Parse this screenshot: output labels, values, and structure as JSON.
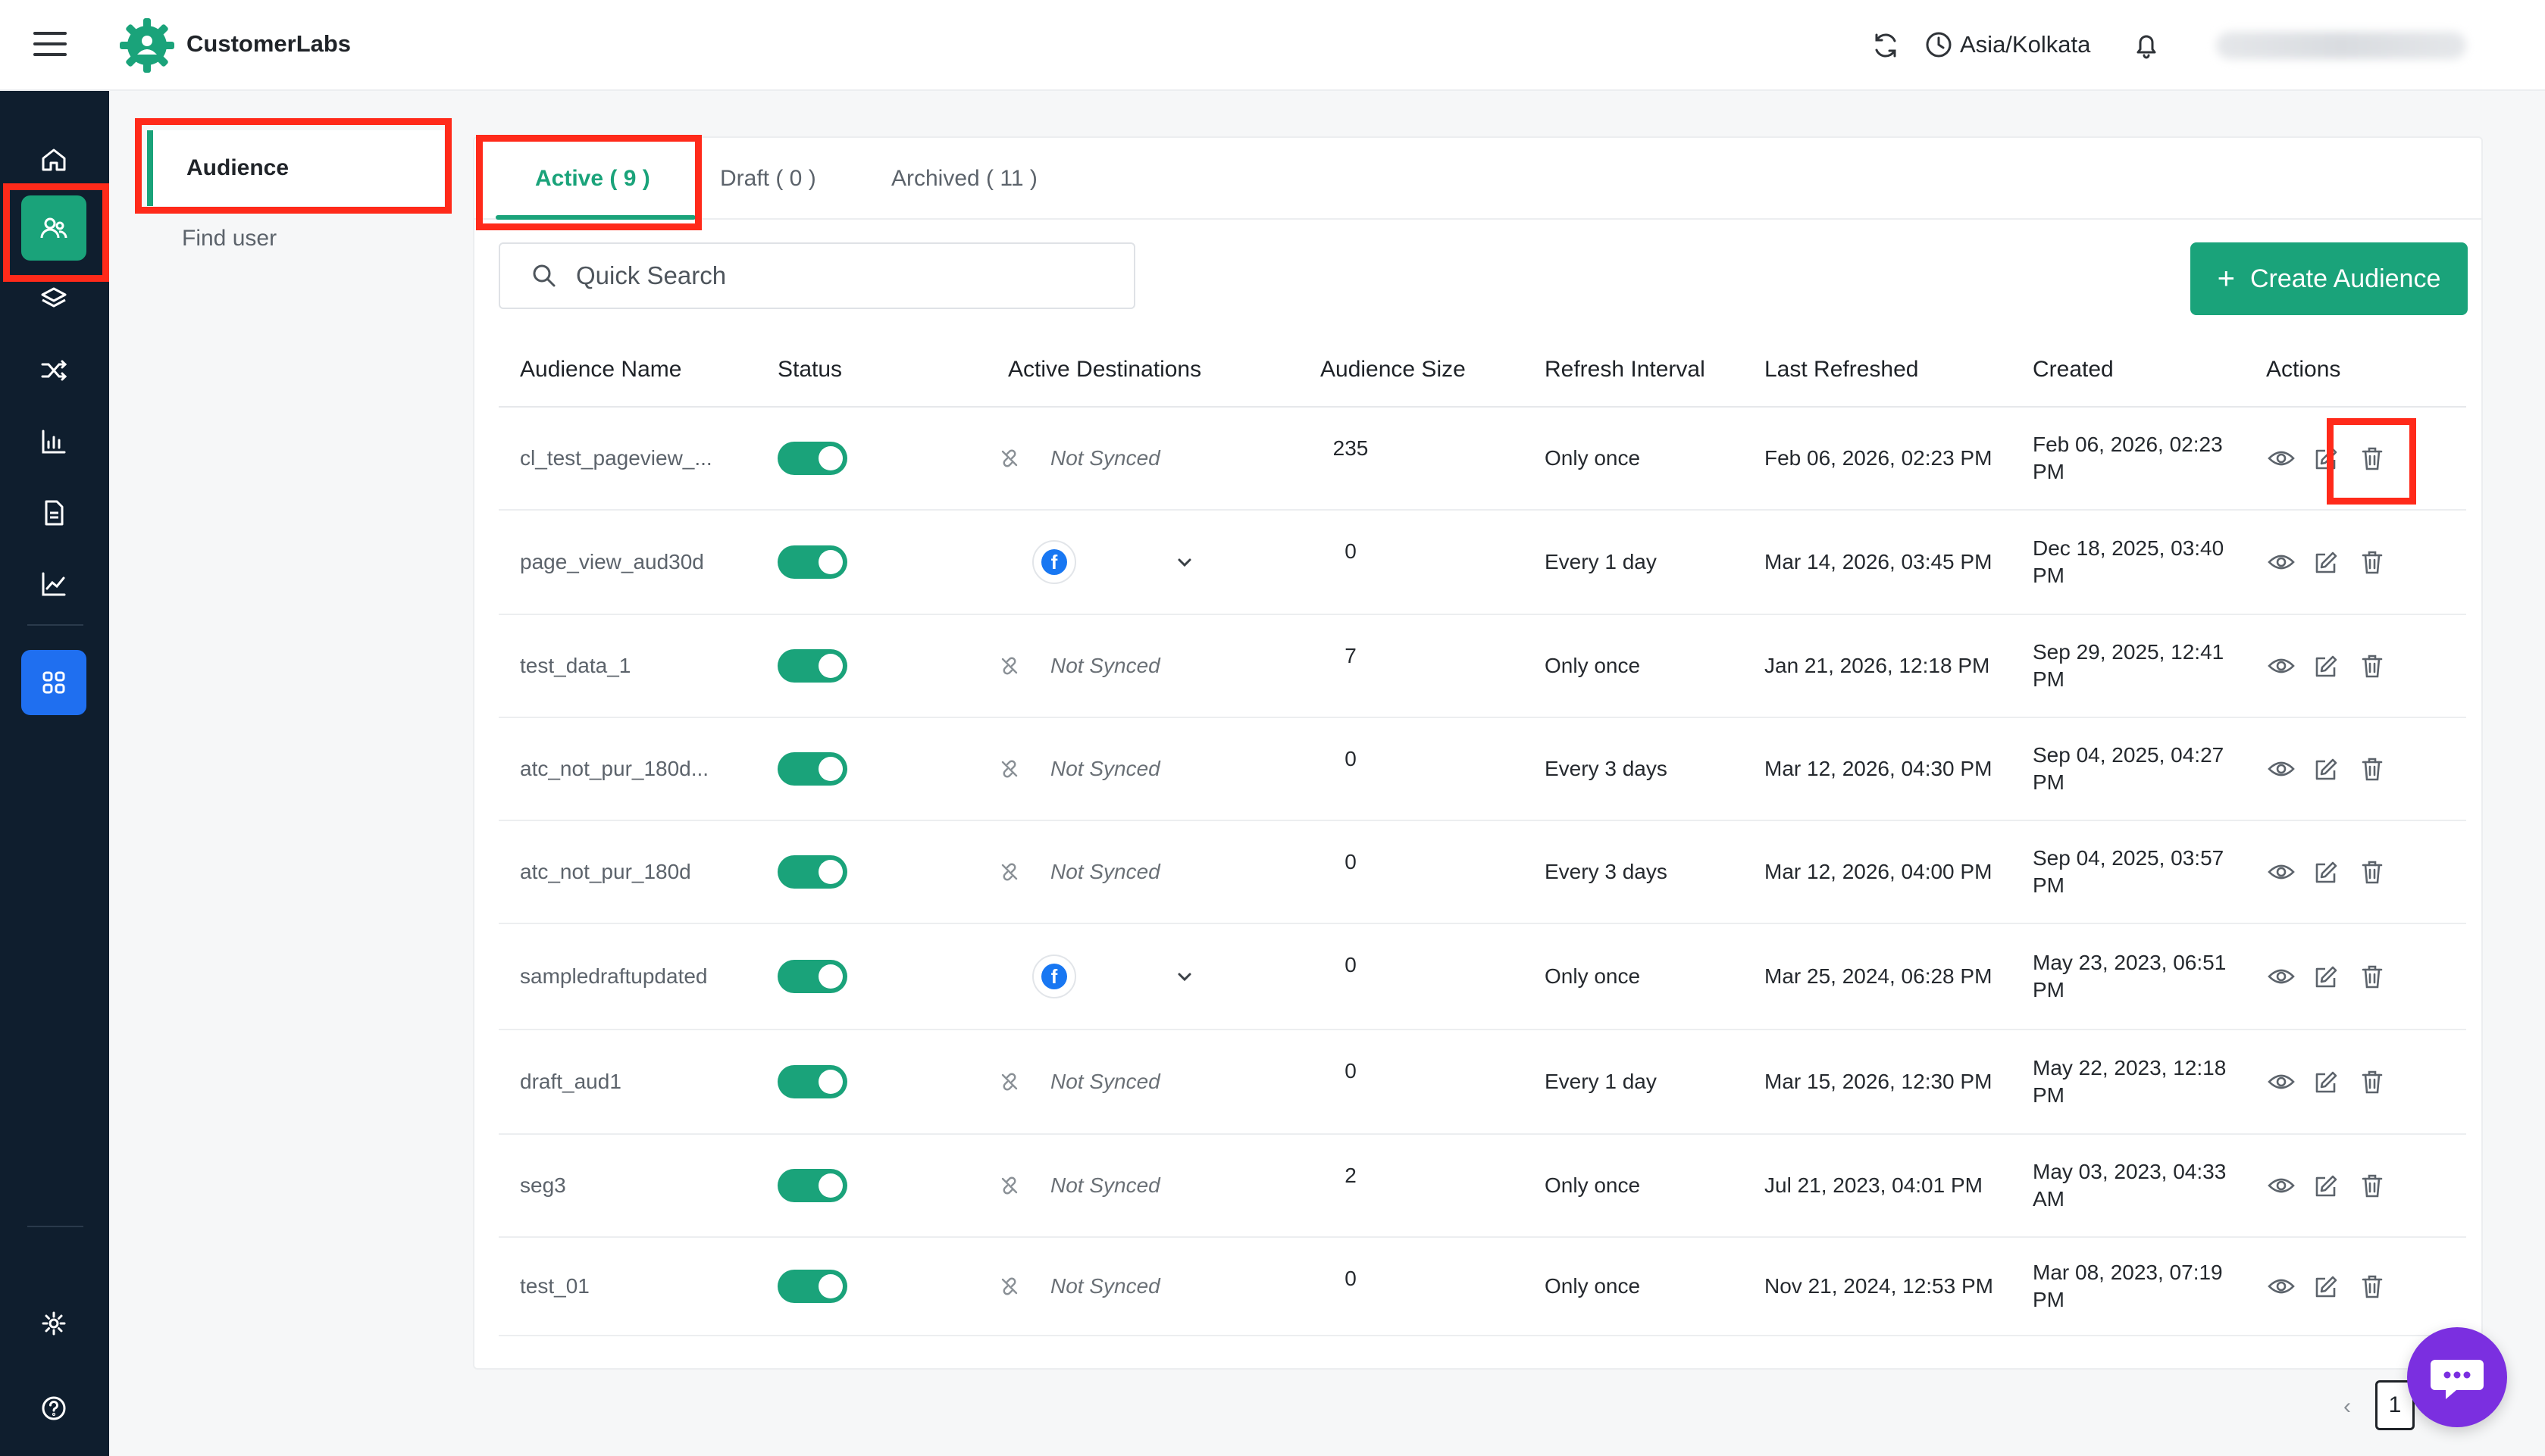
{
  "app": {
    "brand_name": "CustomerLabs",
    "timezone": "Asia/Kolkata"
  },
  "colors": {
    "accent": "#1aa37a",
    "rail_bg": "#0f1e2e",
    "highlight": "#ff2a1a",
    "chat": "#7b2fe0",
    "facebook": "#1877f2"
  },
  "rail": {
    "items": [
      "home-icon",
      "users-icon",
      "layers-icon",
      "shuffle-icon",
      "chart-bar-icon",
      "document-icon",
      "trend-icon",
      "apps-grid-icon",
      "gear-icon",
      "help-icon"
    ],
    "active": "users-icon"
  },
  "subnav": {
    "items": [
      {
        "label": "Audience",
        "active": true
      },
      {
        "label": "Find user",
        "active": false
      }
    ]
  },
  "tabs": [
    {
      "label": "Active ( 9 )",
      "active": true
    },
    {
      "label": "Draft ( 0 )",
      "active": false
    },
    {
      "label": "Archived ( 11 )",
      "active": false
    }
  ],
  "search": {
    "placeholder": "Quick Search",
    "value": ""
  },
  "create_button": {
    "label": "Create Audience"
  },
  "table": {
    "columns": [
      "Audience Name",
      "Status",
      "Active Destinations",
      "Audience Size",
      "Refresh Interval",
      "Last Refreshed",
      "Created",
      "Actions"
    ],
    "rows": [
      {
        "name": "cl_test_pageview_...",
        "status_on": true,
        "destination": "Not Synced",
        "size": "235",
        "interval": "Only once",
        "last_refreshed": "Feb 06, 2026, 02:23 PM",
        "created_line1": "Feb 06, 2026, 02:23",
        "created_line2": "PM"
      },
      {
        "name": "page_view_aud30d",
        "status_on": true,
        "destination": "facebook",
        "size": "0",
        "interval": "Every 1 day",
        "last_refreshed": "Mar 14, 2026, 03:45 PM",
        "created_line1": "Dec 18, 2025, 03:40",
        "created_line2": "PM"
      },
      {
        "name": "test_data_1",
        "status_on": true,
        "destination": "Not Synced",
        "size": "7",
        "interval": "Only once",
        "last_refreshed": "Jan 21, 2026, 12:18 PM",
        "created_line1": "Sep 29, 2025, 12:41",
        "created_line2": "PM"
      },
      {
        "name": "atc_not_pur_180d...",
        "status_on": true,
        "destination": "Not Synced",
        "size": "0",
        "interval": "Every 3 days",
        "last_refreshed": "Mar 12, 2026, 04:30 PM",
        "created_line1": "Sep 04, 2025, 04:27",
        "created_line2": "PM"
      },
      {
        "name": "atc_not_pur_180d",
        "status_on": true,
        "destination": "Not Synced",
        "size": "0",
        "interval": "Every 3 days",
        "last_refreshed": "Mar 12, 2026, 04:00 PM",
        "created_line1": "Sep 04, 2025, 03:57",
        "created_line2": "PM"
      },
      {
        "name": "sampledraftupdated",
        "status_on": true,
        "destination": "facebook",
        "size": "0",
        "interval": "Only once",
        "last_refreshed": "Mar 25, 2024, 06:28 PM",
        "created_line1": "May 23, 2023, 06:51",
        "created_line2": "PM"
      },
      {
        "name": "draft_aud1",
        "status_on": true,
        "destination": "Not Synced",
        "size": "0",
        "interval": "Every 1 day",
        "last_refreshed": "Mar 15, 2026, 12:30 PM",
        "created_line1": "May 22, 2023, 12:18",
        "created_line2": "PM"
      },
      {
        "name": "seg3",
        "status_on": true,
        "destination": "Not Synced",
        "size": "2",
        "interval": "Only once",
        "last_refreshed": "Jul 21, 2023, 04:01 PM",
        "created_line1": "May 03, 2023, 04:33",
        "created_line2": "AM"
      },
      {
        "name": "test_01",
        "status_on": true,
        "destination": "Not Synced",
        "size": "0",
        "interval": "Only once",
        "last_refreshed": "Nov 21, 2024, 12:53 PM",
        "created_line1": "Mar 08, 2023, 07:19",
        "created_line2": "PM"
      }
    ]
  },
  "pagination": {
    "prev": "‹",
    "current_page": "1"
  }
}
